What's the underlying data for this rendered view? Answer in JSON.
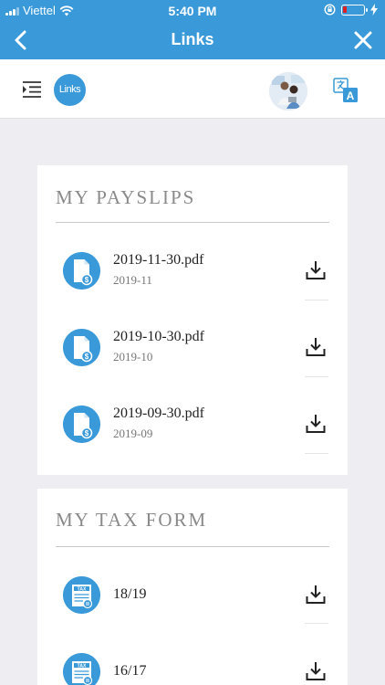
{
  "status_bar": {
    "carrier": "Viettel",
    "time": "5:40 PM"
  },
  "nav": {
    "title": "Links",
    "back_icon": "chevron-left-icon",
    "close_icon": "close-icon"
  },
  "toolbar": {
    "logo_text": "Links",
    "menu_icon": "indent-menu-icon",
    "translate_icon": "translate-icon"
  },
  "colors": {
    "primary": "#3a9ad9",
    "background": "#ededf2",
    "battery_low": "#e02020"
  },
  "payslips": {
    "title": "MY PAYSLIPS",
    "items": [
      {
        "name": "2019-11-30.pdf",
        "period": "2019-11"
      },
      {
        "name": "2019-10-30.pdf",
        "period": "2019-10"
      },
      {
        "name": "2019-09-30.pdf",
        "period": "2019-09"
      }
    ]
  },
  "tax_forms": {
    "title": "MY TAX FORM",
    "icon_text": "TAX",
    "items": [
      {
        "name": "18/19"
      },
      {
        "name": "16/17"
      }
    ]
  }
}
